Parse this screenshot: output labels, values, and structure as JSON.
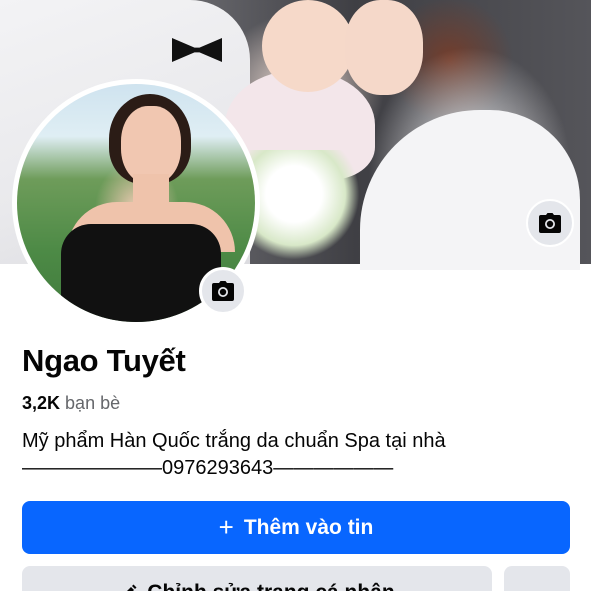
{
  "profile": {
    "name": "Ngao Tuyết",
    "friends_count": "3,2K",
    "friends_label": "bạn bè",
    "bio_line1": "Mỹ phẩm Hàn Quốc trắng da chuẩn Spa tại nhà",
    "bio_line2": "———————0976293643——————"
  },
  "actions": {
    "add_story_icon": "+",
    "add_story_label": "Thêm vào tin",
    "edit_profile_label": "Chỉnh sửa trang cá nhân",
    "more_label": "···"
  },
  "icons": {
    "cover_camera": "camera-icon",
    "avatar_camera": "camera-icon",
    "edit": "pencil-icon"
  },
  "colors": {
    "primary": "#0866ff",
    "secondary_bg": "#e4e6eb",
    "muted_text": "#65676b"
  }
}
